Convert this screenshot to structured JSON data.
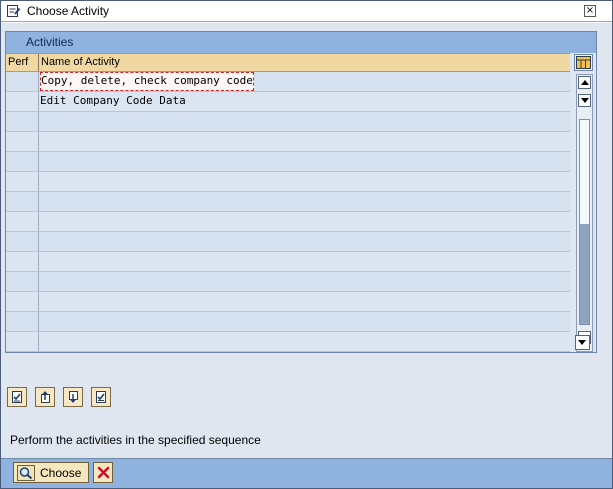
{
  "window": {
    "title": "Choose Activity",
    "title_icon": "document-edit-icon",
    "close_glyph": "×"
  },
  "table": {
    "caption": "Activities",
    "columns": [
      "Perf",
      "Name of Activity"
    ],
    "column_config_icon": "table-settings-icon",
    "rows": [
      {
        "perf": "",
        "name": "Copy, delete, check company code",
        "focused": true
      },
      {
        "perf": "",
        "name": "Edit Company Code Data",
        "focused": false
      },
      {
        "perf": "",
        "name": ""
      },
      {
        "perf": "",
        "name": ""
      },
      {
        "perf": "",
        "name": ""
      },
      {
        "perf": "",
        "name": ""
      },
      {
        "perf": "",
        "name": ""
      },
      {
        "perf": "",
        "name": ""
      },
      {
        "perf": "",
        "name": ""
      },
      {
        "perf": "",
        "name": ""
      },
      {
        "perf": "",
        "name": ""
      },
      {
        "perf": "",
        "name": ""
      },
      {
        "perf": "",
        "name": ""
      },
      {
        "perf": "",
        "name": ""
      }
    ]
  },
  "toolbar": {
    "buttons": [
      {
        "icon": "select-all-icon"
      },
      {
        "icon": "move-up-icon"
      },
      {
        "icon": "move-down-icon"
      },
      {
        "icon": "deselect-all-icon"
      }
    ]
  },
  "hint": "Perform the activities in the specified sequence",
  "footer": {
    "choose_label": "Choose",
    "choose_icon": "magnifier-icon",
    "cancel_icon": "cancel-x-icon"
  },
  "colors": {
    "caption_bar": "#8fb2de",
    "header_row": "#f1d8a2",
    "button_face": "#f7e7bd",
    "focus_outline": "#d32020",
    "cancel_x": "#c8102e"
  }
}
